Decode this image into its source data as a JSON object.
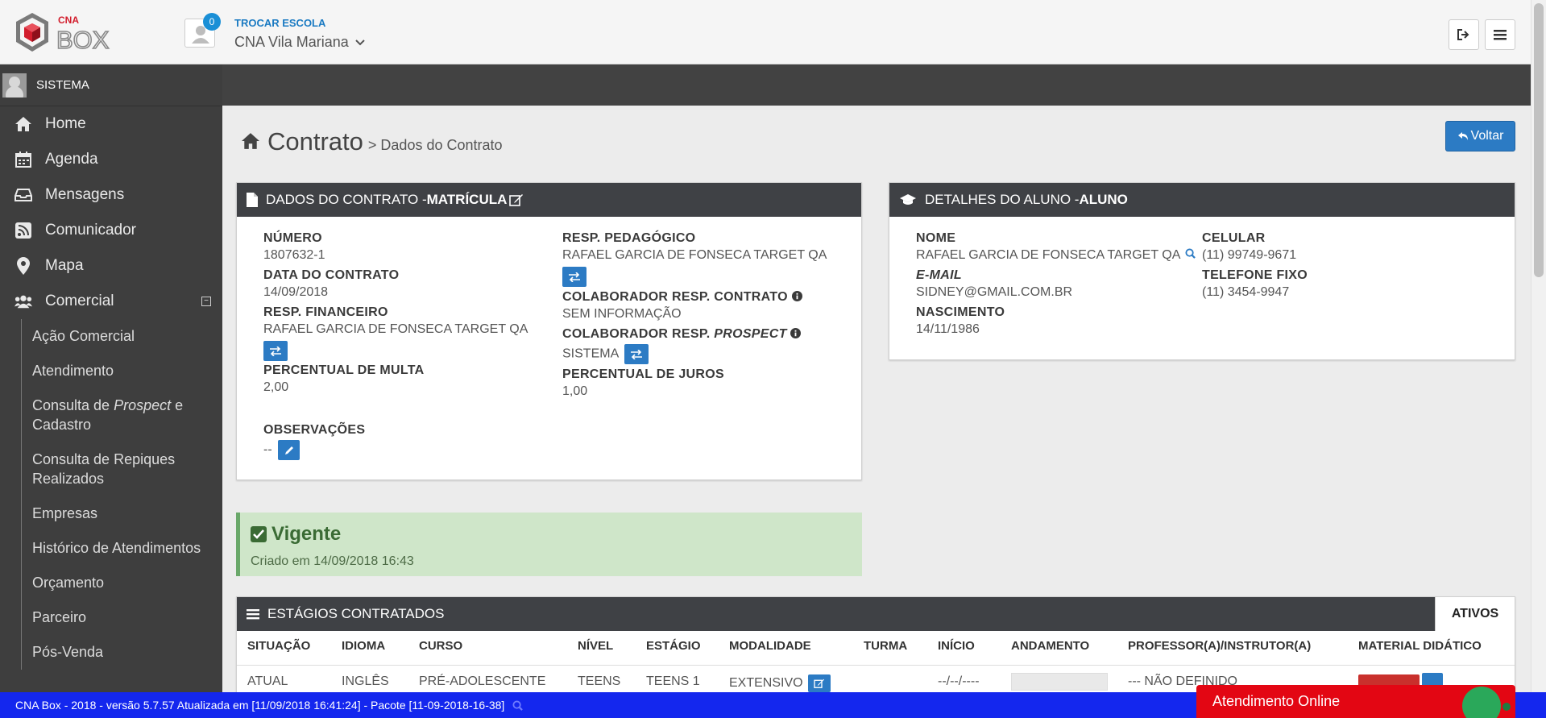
{
  "header": {
    "logo_text": "CNA BOX",
    "notification_count": "0",
    "switch_school_label": "TROCAR ESCOLA",
    "school_name": "CNA Vila Mariana"
  },
  "sidebar": {
    "user": "SISTEMA",
    "items": [
      {
        "label": "Home",
        "icon": "home-icon"
      },
      {
        "label": "Agenda",
        "icon": "calendar-icon"
      },
      {
        "label": "Mensagens",
        "icon": "inbox-icon"
      },
      {
        "label": "Comunicador",
        "icon": "rss-icon"
      },
      {
        "label": "Mapa",
        "icon": "map-marker-icon"
      },
      {
        "label": "Comercial",
        "icon": "users-icon"
      }
    ],
    "collapse_symbol": "−",
    "subitems": [
      {
        "label": "Ação Comercial"
      },
      {
        "label": "Atendimento"
      },
      {
        "prefix": "Consulta de ",
        "em": "Prospect",
        "suffix": " e Cadastro"
      },
      {
        "label": "Consulta de Repiques Realizados"
      },
      {
        "label": "Empresas"
      },
      {
        "label": "Histórico de Atendimentos"
      },
      {
        "label": "Orçamento"
      },
      {
        "label": "Parceiro"
      },
      {
        "label": "Pós-Venda"
      }
    ]
  },
  "page": {
    "title": "Contrato",
    "subtitle": "> Dados do Contrato",
    "back_button": "Voltar"
  },
  "contract": {
    "heading_prefix": "DADOS DO CONTRATO - ",
    "heading_bold": "MATRÍCULA",
    "numero_label": "NÚMERO",
    "numero": "1807632-1",
    "data_label": "DATA DO CONTRATO",
    "data": "14/09/2018",
    "resp_fin_label": "RESP. FINANCEIRO",
    "resp_fin": "RAFAEL GARCIA DE FONSECA TARGET QA",
    "multa_label": "PERCENTUAL DE MULTA",
    "multa": "2,00",
    "obs_label": "OBSERVAÇÕES",
    "obs": "--",
    "resp_ped_label": "RESP. PEDAGÓGICO",
    "resp_ped": "RAFAEL GARCIA DE FONSECA TARGET QA",
    "colab_contrato_label": "COLABORADOR RESP. CONTRATO",
    "colab_contrato": "SEM INFORMAÇÃO",
    "colab_prospect_label_prefix": "COLABORADOR RESP. ",
    "colab_prospect_label_em": "PROSPECT",
    "colab_prospect": "SISTEMA",
    "juros_label": "PERCENTUAL DE JUROS",
    "juros": "1,00"
  },
  "student": {
    "heading_prefix": "DETALHES DO ALUNO - ",
    "heading_bold": "ALUNO",
    "nome_label": "NOME",
    "nome": "RAFAEL GARCIA DE FONSECA TARGET QA",
    "email_label": "E-MAIL",
    "email": "SIDNEY@GMAIL.COM.BR",
    "nascimento_label": "NASCIMENTO",
    "nascimento": "14/11/1986",
    "celular_label": "CELULAR",
    "celular": "(11) 99749-9671",
    "fixo_label": "TELEFONE FIXO",
    "fixo": "(11) 3454-9947"
  },
  "status": {
    "title": "Vigente",
    "created": "Criado em 14/09/2018 16:43",
    "color": "#cfe6c9"
  },
  "stages": {
    "heading": "ESTÁGIOS CONTRATADOS",
    "tab": "ATIVOS",
    "columns": [
      "SITUAÇÃO",
      "IDIOMA",
      "CURSO",
      "NÍVEL",
      "ESTÁGIO",
      "MODALIDADE",
      "TURMA",
      "INÍCIO",
      "ANDAMENTO",
      "PROFESSOR(A)/INSTRUTOR(A)",
      "MATERIAL DIDÁTICO"
    ],
    "row": {
      "situacao": "ATUAL",
      "idioma": "INGLÊS",
      "curso": "PRÉ-ADOLESCENTE",
      "nivel": "TEENS",
      "estagio": "TEENS 1",
      "modalidade": "EXTENSIVO",
      "turma": "",
      "inicio": "--/--/----",
      "professor": "--- NÃO DEFINIDO"
    }
  },
  "footer": {
    "text": "CNA Box - 2018 - versão 5.7.57 Atualizada em [11/09/2018 16:41:24] - Pacote [11-09-2018-16-38]",
    "chat": "Atendimento Online"
  }
}
